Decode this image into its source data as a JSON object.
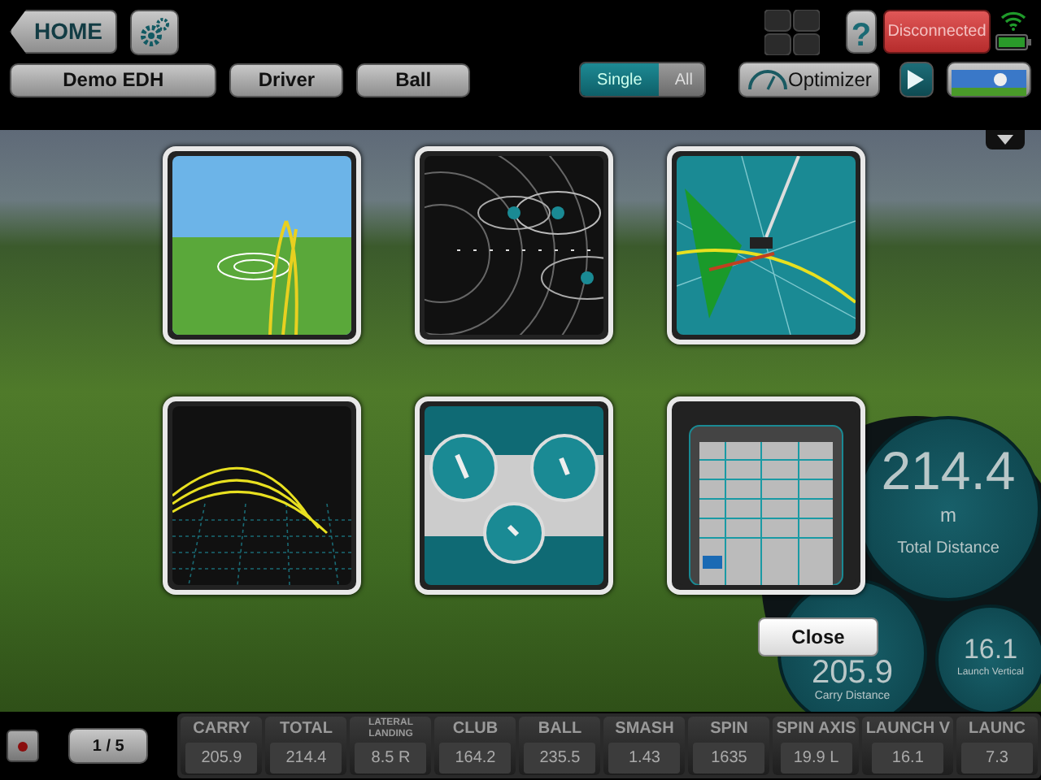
{
  "header": {
    "home_button": "HOME",
    "help_button": "?",
    "connection_status": "Disconnected",
    "connected": false
  },
  "toolbar": {
    "profile": "Demo EDH",
    "club": "Driver",
    "ball": "Ball",
    "view_modes": [
      {
        "label": "Single",
        "selected": true
      },
      {
        "label": "All",
        "selected": false
      }
    ],
    "optimizer_button": "Optimizer"
  },
  "view_thumbnails": [
    {
      "kind": "landing"
    },
    {
      "kind": "dispersion"
    },
    {
      "kind": "club-path"
    },
    {
      "kind": "trajectory"
    },
    {
      "kind": "gauges"
    },
    {
      "kind": "table"
    }
  ],
  "summary": {
    "total_distance": {
      "value": "214.4",
      "unit": "m",
      "label": "Total Distance"
    },
    "carry_distance": {
      "value": "205.9",
      "label": "Carry Distance"
    },
    "launch_vertical": {
      "value": "16.1",
      "label": "Launch Vertical"
    }
  },
  "close_button": "Close",
  "footer": {
    "shot_counter": "1 / 5",
    "metrics": [
      {
        "kind": "standard",
        "label": "CARRY",
        "value": "205.9"
      },
      {
        "kind": "standard",
        "label": "TOTAL",
        "value": "214.4"
      },
      {
        "kind": "compact",
        "label": "LATERAL LANDING",
        "value": "8.5 R"
      },
      {
        "kind": "standard",
        "label": "CLUB",
        "value": "164.2"
      },
      {
        "kind": "standard",
        "label": "BALL",
        "value": "235.5"
      },
      {
        "kind": "standard",
        "label": "SMASH",
        "value": "1.43"
      },
      {
        "kind": "standard",
        "label": "SPIN",
        "value": "1635"
      },
      {
        "kind": "standard",
        "label": "SPIN AXIS",
        "value": "19.9 L"
      },
      {
        "kind": "standard",
        "label": "LAUNCH V",
        "value": "16.1"
      },
      {
        "kind": "standard",
        "label": "LAUNC",
        "value": "7.3"
      }
    ]
  }
}
